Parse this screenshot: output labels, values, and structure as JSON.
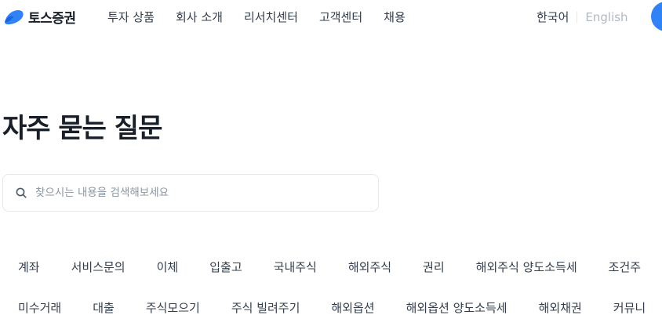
{
  "header": {
    "logo_text": "토스증권",
    "nav": [
      "투자 상품",
      "회사 소개",
      "리서치센터",
      "고객센터",
      "채용"
    ],
    "lang_ko": "한국어",
    "lang_en": "English"
  },
  "page_title": "자주 묻는 질문",
  "search": {
    "placeholder": "찾으시는 내용을 검색해보세요",
    "value": ""
  },
  "categories_row1": [
    "계좌",
    "서비스문의",
    "이체",
    "입출고",
    "국내주식",
    "해외주식",
    "권리",
    "해외주식 양도소득세",
    "조건주"
  ],
  "categories_row2": [
    "미수거래",
    "대출",
    "주식모으기",
    "주식 빌려주기",
    "해외옵션",
    "해외옵션 양도소득세",
    "해외채권",
    "커뮤니"
  ],
  "colors": {
    "brand_blue": "#3182f6",
    "text_primary": "#191f28",
    "text_secondary": "#333d4b",
    "text_muted": "#b0b8c1",
    "border": "#e5e8eb"
  },
  "icons": {
    "logo": "toss-logo-icon",
    "search": "search-icon"
  }
}
